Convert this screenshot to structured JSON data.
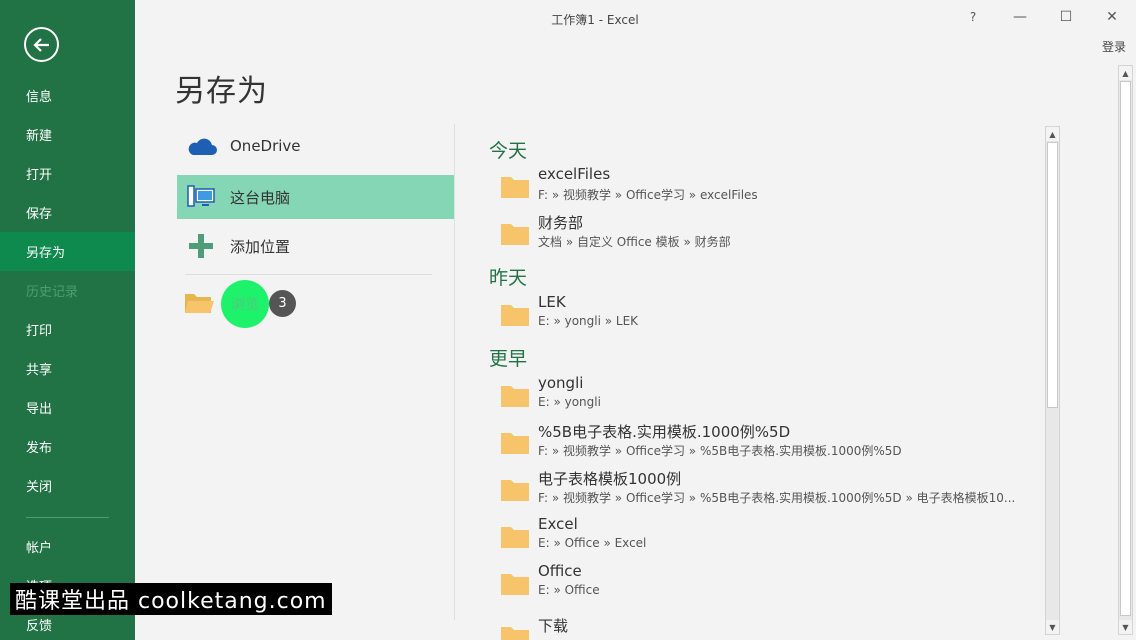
{
  "window": {
    "title": "工作簿1 - Excel",
    "help": "?",
    "minimize": "—",
    "maximize": "☐",
    "close": "✕",
    "login": "登录"
  },
  "sidebar": {
    "items": [
      {
        "label": "信息"
      },
      {
        "label": "新建"
      },
      {
        "label": "打开"
      },
      {
        "label": "保存"
      },
      {
        "label": "另存为"
      },
      {
        "label": "历史记录"
      },
      {
        "label": "打印"
      },
      {
        "label": "共享"
      },
      {
        "label": "导出"
      },
      {
        "label": "发布"
      },
      {
        "label": "关闭"
      },
      {
        "label": "帐户"
      },
      {
        "label": "选项"
      },
      {
        "label": "反馈"
      }
    ]
  },
  "page_title": "另存为",
  "locations": {
    "onedrive": "OneDrive",
    "this_pc": "这台电脑",
    "add_place": "添加位置",
    "browse": "浏览",
    "badge": "3"
  },
  "recent": {
    "groups": [
      "今天",
      "昨天",
      "更早"
    ],
    "folders": [
      {
        "name": "excelFiles",
        "path": "F: » 视频教学 » Office学习 » excelFiles"
      },
      {
        "name": "财务部",
        "path": "文档 » 自定义 Office 模板 » 财务部"
      },
      {
        "name": "LEK",
        "path": "E: » yongli » LEK"
      },
      {
        "name": "yongli",
        "path": "E: » yongli"
      },
      {
        "name": "%5B电子表格.实用模板.1000例%5D",
        "path": "F: » 视频教学 » Office学习 » %5B电子表格.实用模板.1000例%5D"
      },
      {
        "name": "电子表格模板1000例",
        "path": "F: » 视频教学 » Office学习 » %5B电子表格.实用模板.1000例%5D » 电子表格模板10..."
      },
      {
        "name": "Excel",
        "path": "E: » Office » Excel"
      },
      {
        "name": "Office",
        "path": "E: » Office"
      },
      {
        "name": "下载",
        "path": ""
      }
    ]
  },
  "watermark": "酷课堂出品 coolketang.com",
  "colors": {
    "sidebar": "#217346",
    "active": "#0f8a4f",
    "selected": "#85d6b5",
    "highlight": "#1ef26b",
    "folder": "#f7c46c"
  }
}
